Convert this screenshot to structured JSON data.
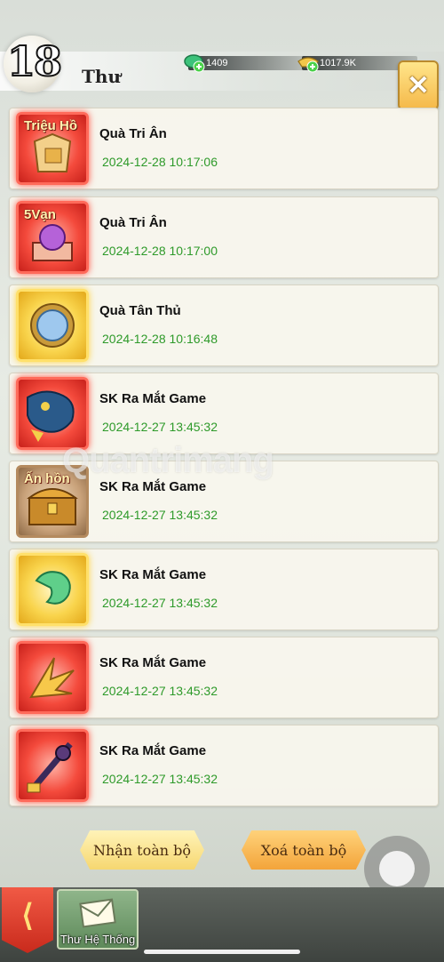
{
  "header": {
    "level": "18",
    "title": "Thư",
    "jade_amount": "1409",
    "gold_amount": "1017.9K",
    "close_label": "✕"
  },
  "mails": [
    {
      "name": "Quà Tri Ân",
      "date": "2024-12-28 10:17:06",
      "thumb_label": "Triệu Hồ",
      "thumb_style": "red",
      "icon": "scroll-pouch-icon"
    },
    {
      "name": "Quà Tri Ân",
      "date": "2024-12-28 10:17:00",
      "thumb_label": "5Vạn",
      "thumb_style": "red",
      "icon": "purple-orb-chest-icon"
    },
    {
      "name": "Quà Tân Thủ",
      "date": "2024-12-28 10:16:48",
      "thumb_label": "",
      "thumb_style": "gold",
      "icon": "blue-jade-disc-icon"
    },
    {
      "name": "SK Ra Mắt Game",
      "date": "2024-12-27 13:45:32",
      "thumb_label": "",
      "thumb_style": "red",
      "icon": "dragon-mount-icon"
    },
    {
      "name": "SK Ra Mắt Game",
      "date": "2024-12-27 13:45:32",
      "thumb_label": "Ấn hồn",
      "thumb_style": "brown",
      "icon": "treasure-chest-icon"
    },
    {
      "name": "SK Ra Mắt Game",
      "date": "2024-12-27 13:45:32",
      "thumb_label": "",
      "thumb_style": "gold",
      "icon": "green-jade-pendant-icon"
    },
    {
      "name": "SK Ra Mắt Game",
      "date": "2024-12-27 13:45:32",
      "thumb_label": "",
      "thumb_style": "red",
      "icon": "golden-wing-icon"
    },
    {
      "name": "SK Ra Mắt Game",
      "date": "2024-12-27 13:45:32",
      "thumb_label": "",
      "thumb_style": "red",
      "icon": "spiked-weapon-icon"
    }
  ],
  "watermark": "Quantrimang",
  "actions": {
    "receive_all": "Nhận toàn bộ",
    "delete_all": "Xoá toàn bộ"
  },
  "bottom_bar": {
    "back_label": "⟨",
    "system_tab_label": "Thư Hệ Thống"
  },
  "colors": {
    "date_green": "#2e9a2a",
    "accent_gold": "#f6d770",
    "accent_red": "#f44a3c"
  }
}
